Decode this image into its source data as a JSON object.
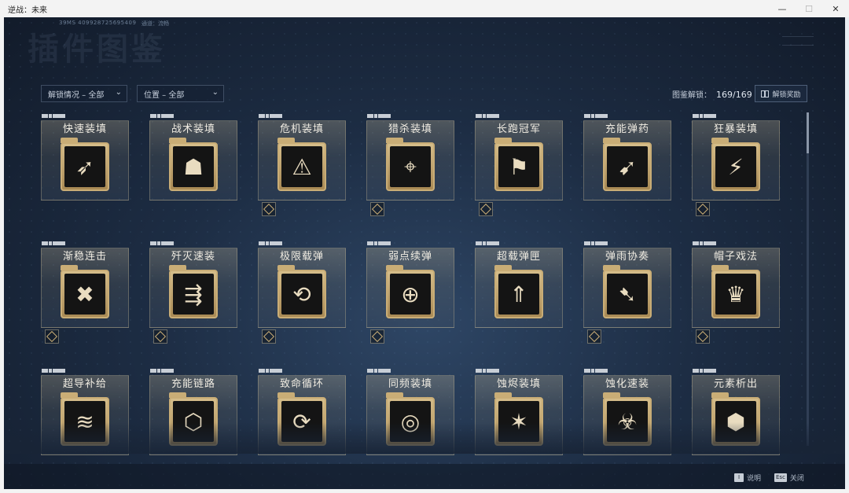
{
  "window": {
    "title": "逆战：未来",
    "minimize": "—",
    "maximize": "☐",
    "close": "✕"
  },
  "hud": {
    "ping": "39MS  4099287256954​09",
    "route": "通道：流畅",
    "page_title": "插件图鉴"
  },
  "filters": [
    {
      "label": "解锁情况 – 全部",
      "chevron": "⌄"
    },
    {
      "label": "位置 – 全部",
      "chevron": "⌄"
    }
  ],
  "unlock": {
    "label": "图鉴解锁：",
    "value": "169/169",
    "reward_button": "解锁奖励"
  },
  "cards": [
    {
      "name": "快速装填",
      "glyph": "➶",
      "badge": false
    },
    {
      "name": "战术装填",
      "glyph": "☗",
      "badge": false
    },
    {
      "name": "危机装填",
      "glyph": "⚠",
      "badge": true
    },
    {
      "name": "猎杀装填",
      "glyph": "⌖",
      "badge": true
    },
    {
      "name": "长跑冠军",
      "glyph": "⚑",
      "badge": true
    },
    {
      "name": "充能弹药",
      "glyph": "➹",
      "badge": false
    },
    {
      "name": "狂暴装填",
      "glyph": "⚡",
      "badge": true
    },
    {
      "name": "渐稳连击",
      "glyph": "✖",
      "badge": true
    },
    {
      "name": "歼灭速装",
      "glyph": "⇶",
      "badge": true
    },
    {
      "name": "极限载弹",
      "glyph": "⟲",
      "badge": true
    },
    {
      "name": "弱点续弹",
      "glyph": "⊕",
      "badge": true
    },
    {
      "name": "超载弹匣",
      "glyph": "⇑",
      "badge": false
    },
    {
      "name": "弹雨协奏",
      "glyph": "➷",
      "badge": true
    },
    {
      "name": "帽子戏法",
      "glyph": "♛",
      "badge": true
    },
    {
      "name": "超导补给",
      "glyph": "≋",
      "badge": false
    },
    {
      "name": "充能链路",
      "glyph": "⬡",
      "badge": false
    },
    {
      "name": "致命循环",
      "glyph": "⟳",
      "badge": false
    },
    {
      "name": "同频装填",
      "glyph": "◎",
      "badge": false
    },
    {
      "name": "蚀烬装填",
      "glyph": "✶",
      "badge": false
    },
    {
      "name": "蚀化速装",
      "glyph": "☣",
      "badge": false
    },
    {
      "name": "元素析出",
      "glyph": "⬢",
      "badge": false
    }
  ],
  "footer": [
    {
      "key": "I",
      "label": "说明"
    },
    {
      "key": "Esc",
      "label": "关闭"
    }
  ],
  "colors": {
    "gold": "#c9ad76",
    "bg": "#1d2d44",
    "text": "#f0ece2"
  }
}
